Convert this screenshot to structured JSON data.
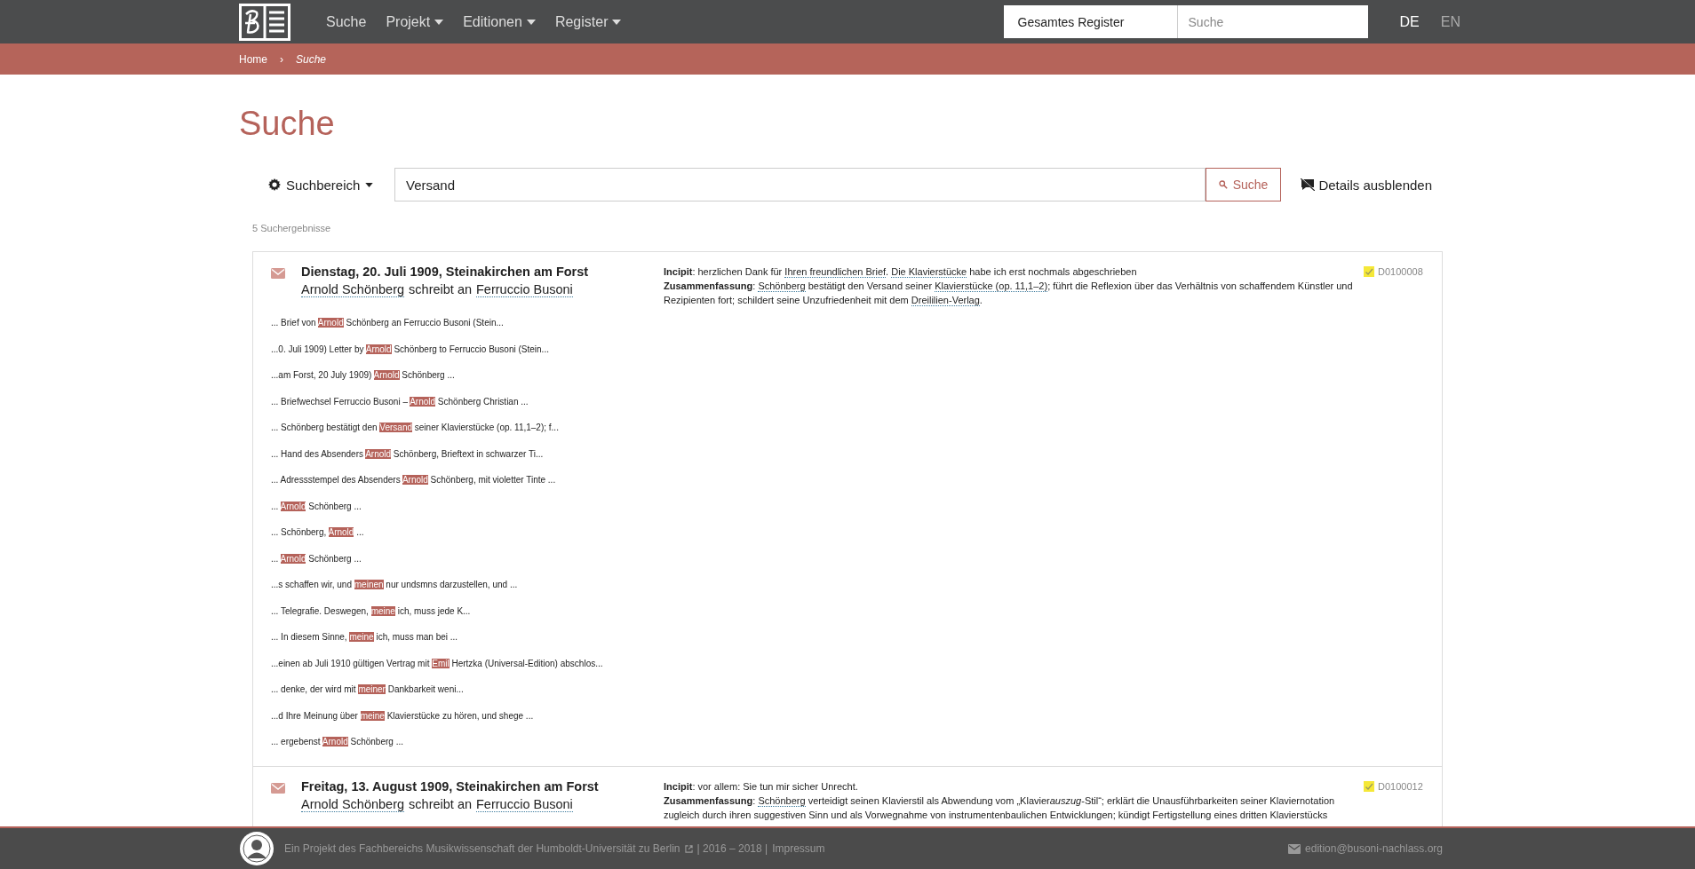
{
  "header": {
    "nav": [
      {
        "label": "Suche",
        "dropdown": false
      },
      {
        "label": "Projekt",
        "dropdown": true
      },
      {
        "label": "Editionen",
        "dropdown": true
      },
      {
        "label": "Register",
        "dropdown": true
      }
    ],
    "register_search": {
      "scope": "Gesamtes Register",
      "placeholder": "Suche"
    },
    "languages": [
      {
        "label": "DE",
        "selected": true
      },
      {
        "label": "EN",
        "selected": false
      }
    ]
  },
  "breadcrumb": {
    "separator": "›",
    "items": [
      {
        "label": "Home",
        "current": false
      },
      {
        "label": "Suche",
        "current": true
      }
    ]
  },
  "page_title": "Suche",
  "search": {
    "scope_button": "Suchbereich",
    "value": "Versand",
    "submit": "Suche",
    "details_toggle": "Details ausblenden"
  },
  "result_count": "5 Suchergebnisse",
  "results": [
    {
      "kind": "letter",
      "title": "Dienstag, 20. Juli 1909, Steinakirchen am Forst",
      "sender": "Arnold Schönberg",
      "verb": "schreibt an",
      "recipient": "Ferruccio Busoni",
      "verified": true,
      "id": "D0100008",
      "incipit_label": "Incipit",
      "incipit": [
        {
          "text": ": herzlichen Dank für "
        },
        {
          "link": "Ihren freundlichen Brief"
        },
        {
          "text": ". "
        },
        {
          "link": "Die Klavierstücke"
        },
        {
          "text": " habe ich erst nochmals abgeschrieben"
        }
      ],
      "summary_label": "Zusammenfassung",
      "summary": [
        {
          "text": ": "
        },
        {
          "link": "Schönberg"
        },
        {
          "text": " bestätigt den Versand seiner "
        },
        {
          "link": "Klavierstücke (op. 11,1–2)"
        },
        {
          "text": "; führt die Reflexion über das Verhältnis von schaffendem Künstler und Rezipienten fort; schildert seine Unzufriedenheit mit dem "
        },
        {
          "link": "Dreililien-Verlag"
        },
        {
          "text": "."
        }
      ],
      "snippets": [
        {
          "pre": "... Brief von ",
          "hit": "Arnold",
          "post": " Schönberg an Ferruccio Busoni (Stein..."
        },
        {
          "pre": "...0. Juli 1909) Letter by ",
          "hit": "Arnold",
          "post": " Schönberg to Ferruccio Busoni (Stein..."
        },
        {
          "pre": "...am Forst, 20 July 1909) ",
          "hit": "Arnold",
          "post": " Schönberg ..."
        },
        {
          "pre": "... Briefwechsel Ferruccio Busoni – ",
          "hit": "Arnold",
          "post": " Schönberg Christian ..."
        },
        {
          "pre": "... Schönberg bestätigt den ",
          "hit": "Versand",
          "post": " seiner Klavierstücke (op. 11,1–2); f..."
        },
        {
          "pre": "... Hand des Absenders ",
          "hit": "Arnold",
          "post": " Schönberg, Brieftext in schwarzer Ti..."
        },
        {
          "pre": "... Adressstempel des Absenders ",
          "hit": "Arnold",
          "post": " Schönberg, mit violetter Tinte ..."
        },
        {
          "pre": "... ",
          "hit": "Arnold",
          "post": " Schönberg ..."
        },
        {
          "pre": "... Schönberg, ",
          "hit": "Arnold",
          "post": " ..."
        },
        {
          "pre": "... ",
          "hit": "Arnold",
          "post": " Schönberg ..."
        },
        {
          "pre": "...s schaffen wir, und ",
          "hit": "meinen",
          "post": " nur undsmns darzustellen, und ..."
        },
        {
          "pre": "... Telegrafie. Deswegen, ",
          "hit": "meine",
          "post": " ich, muss jede K..."
        },
        {
          "pre": "... In diesem Sinne, ",
          "hit": "meine",
          "post": " ich, muss man bei ..."
        },
        {
          "pre": "...einen ab Juli 1910 gültigen Vertrag mit ",
          "hit": "Emil",
          "post": " Hertzka (Universal-Edition) abschlos..."
        },
        {
          "pre": "... denke, der wird mit ",
          "hit": "meiner",
          "post": " Dankbarkeit weni..."
        },
        {
          "pre": "...d Ihre Meinung über ",
          "hit": "meine",
          "post": " Klavierstücke zu hören, und shege ..."
        },
        {
          "pre": "... ergebenst ",
          "hit": "Arnold",
          "post": " Schönberg ..."
        }
      ]
    },
    {
      "kind": "letter",
      "title": "Freitag, 13. August 1909, Steinakirchen am Forst",
      "sender": "Arnold Schönberg",
      "verb": "schreibt an",
      "recipient": "Ferruccio Busoni",
      "verified": true,
      "id": "D0100012",
      "incipit_label": "Incipit",
      "incipit": [
        {
          "text": ": vor allem: Sie tun mir sicher Unrecht."
        }
      ],
      "summary_label": "Zusammenfassung",
      "summary": [
        {
          "text": ": "
        },
        {
          "link": "Schönberg"
        },
        {
          "text": " verteidigt seinen Klavierstil als Abwendung vom „Klavier"
        },
        {
          "emphasis": "auszug"
        },
        {
          "text": "-Stil“; erklärt die Unausführbarkeiten seiner Klaviernotation zugleich durch ihren suggestiven Sinn und als Vorwegnahme von instrumentenbaulichen Entwicklungen; kündigt Fertigstellung eines dritten Klavierstücks"
        }
      ]
    }
  ],
  "footer": {
    "project": "Ein Projekt des Fachbereichs Musikwissenschaft der Humboldt-Universität zu Berlin",
    "years": "| 2016 – 2018 |",
    "imprint": "Impressum",
    "email": "edition@busoni-nachlass.org"
  }
}
